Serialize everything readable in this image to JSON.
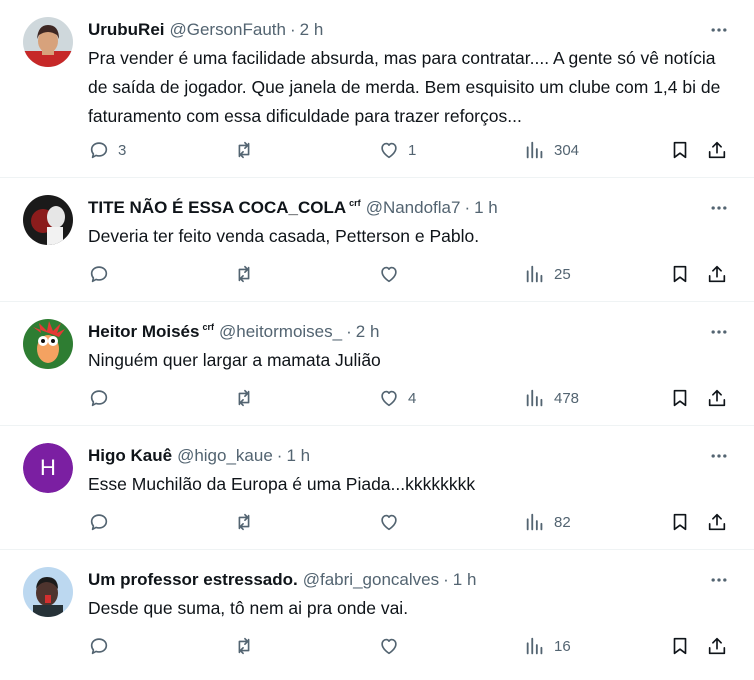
{
  "tweets": [
    {
      "name": "UrubuRei",
      "badge": "",
      "handle": "@GersonFauth",
      "separator": "·",
      "time": "2 h",
      "text": "Pra vender é uma facilidade absurda, mas para contratar.... A gente só vê notícia de saída de jogador. Que janela de merda. Bem esquisito um clube com 1,4 bi de faturamento com essa dificuldade para trazer reforços...",
      "replies": "3",
      "retweets": "",
      "likes": "1",
      "views": "304"
    },
    {
      "name": "TITE NÃO É ESSA COCA_COLA",
      "badge": "crf",
      "handle": "@Nandofla7",
      "separator": "·",
      "time": "1 h",
      "text": "Deveria ter feito venda casada, Petterson e Pablo.",
      "replies": "",
      "retweets": "",
      "likes": "",
      "views": "25"
    },
    {
      "name": "Heitor Moisés",
      "badge": "crf",
      "handle": "@heitormoises_",
      "separator": "·",
      "time": "2 h",
      "text": "Ninguém quer largar a mamata Julião",
      "replies": "",
      "retweets": "",
      "likes": "4",
      "views": "478"
    },
    {
      "name": "Higo Kauê",
      "badge": "",
      "handle": "@higo_kaue",
      "separator": "·",
      "time": "1 h",
      "avatar_letter": "H",
      "text": "Esse Muchilão da Europa é uma Piada...kkkkkkkk",
      "replies": "",
      "retweets": "",
      "likes": "",
      "views": "82"
    },
    {
      "name": "Um professor estressado.",
      "badge": "",
      "handle": "@fabri_goncalves",
      "separator": "·",
      "time": "1 h",
      "text": "Desde que suma, tô nem ai pra onde vai.",
      "replies": "",
      "retweets": "",
      "likes": "",
      "views": "16"
    }
  ],
  "icons": {
    "more": "more-icon",
    "reply": "reply-icon",
    "retweet": "retweet-icon",
    "like": "like-icon",
    "views": "views-icon",
    "bookmark": "bookmark-icon",
    "share": "share-icon"
  },
  "colors": {
    "text": "#0f1419",
    "secondary": "#536471",
    "divider": "#eff3f4",
    "avatar_purple": "#7b1fa2"
  }
}
